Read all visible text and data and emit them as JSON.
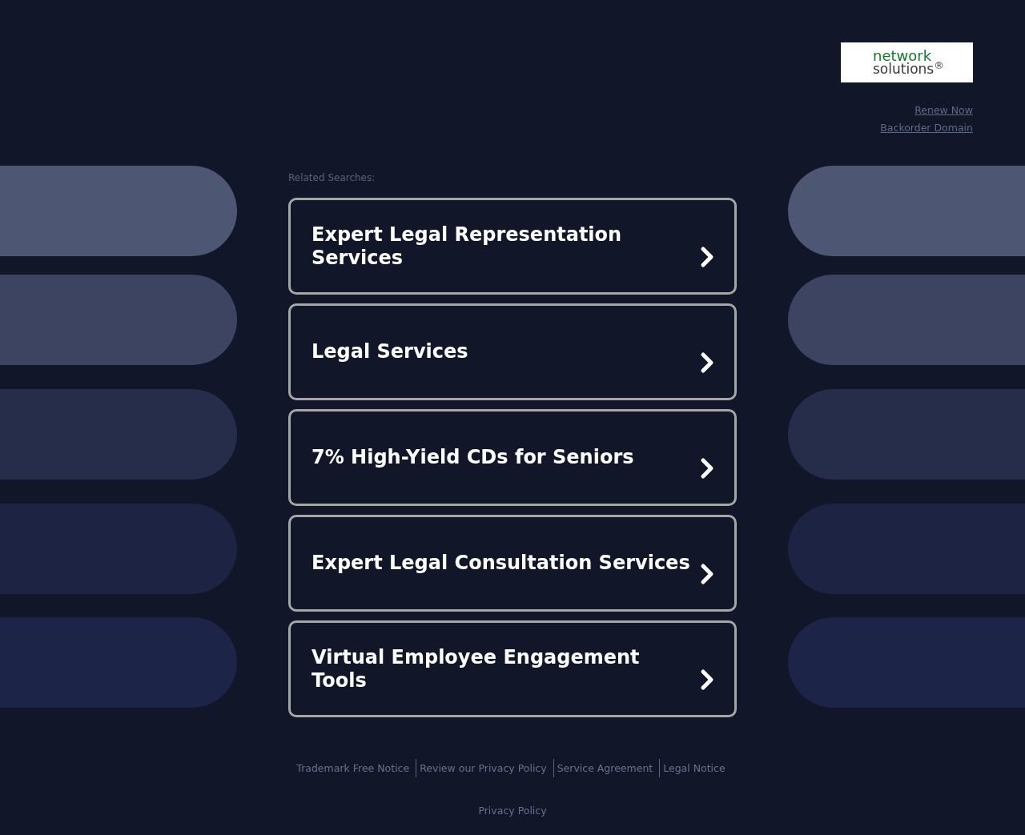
{
  "logo": {
    "line_1": "network",
    "line_2": "solutions$^{®}$"
  },
  "header_links": [
    "Renew Now",
    "Backorder Domain"
  ],
  "related_searches": {
    "label": "Related Searches:",
    "items": [
      "Expert Legal Representation Services",
      "Legal Services",
      "7% High-Yield CDs for Seniors",
      "Expert Legal Consultation Services",
      "Virtual Employee Engagement Tools"
    ]
  },
  "footer_links": [
    "Trademark Free Notice",
    "Review our Privacy Policy",
    "Service Agreement",
    "Legal Notice"
  ],
  "footer_bottom_link": "Privacy Policy"
}
